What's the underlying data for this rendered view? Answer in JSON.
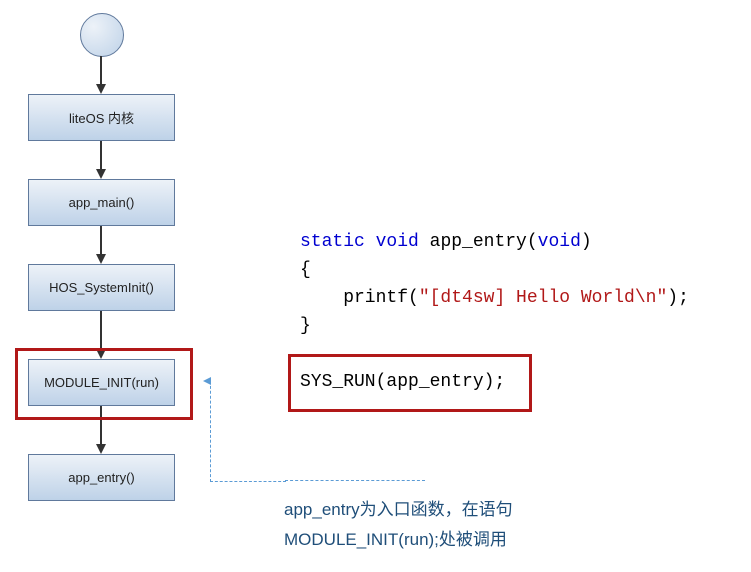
{
  "chart_data": {
    "type": "flowchart",
    "nodes": [
      {
        "id": "start",
        "type": "start",
        "label": ""
      },
      {
        "id": "n1",
        "type": "process",
        "label": "liteOS 内核"
      },
      {
        "id": "n2",
        "type": "process",
        "label": "app_main()"
      },
      {
        "id": "n3",
        "type": "process",
        "label": "HOS_SystemInit()"
      },
      {
        "id": "n4",
        "type": "process",
        "label": "MODULE_INIT(run)",
        "highlighted": true
      },
      {
        "id": "n5",
        "type": "process",
        "label": "app_entry()"
      }
    ],
    "edges": [
      {
        "from": "start",
        "to": "n1"
      },
      {
        "from": "n1",
        "to": "n2"
      },
      {
        "from": "n2",
        "to": "n3"
      },
      {
        "from": "n3",
        "to": "n4"
      },
      {
        "from": "n4",
        "to": "n5"
      }
    ]
  },
  "flow": {
    "n1": "liteOS 内核",
    "n2": "app_main()",
    "n3": "HOS_SystemInit()",
    "n4": "MODULE_INIT(run)",
    "n5": "app_entry()"
  },
  "code": {
    "kw_static": "static",
    "kw_void1": "void",
    "fn_name": " app_entry(",
    "kw_void2": "void",
    "paren_close": ")",
    "brace_open": "{",
    "body": "    printf(",
    "str": "\"[dt4sw] Hello World\\n\"",
    "body_end": ");",
    "brace_close": "}",
    "sysrun": "SYS_RUN(app_entry);"
  },
  "annotation": {
    "line1": "app_entry为入口函数，在语句",
    "line2": "MODULE_INIT(run);处被调用"
  }
}
